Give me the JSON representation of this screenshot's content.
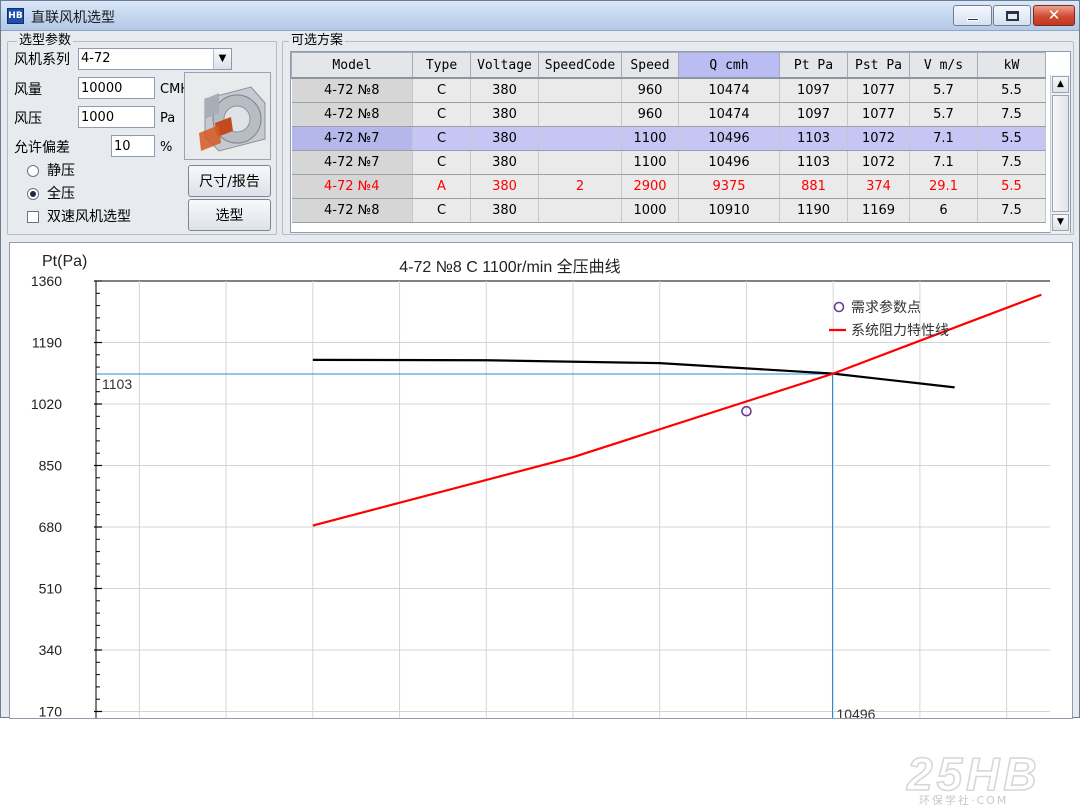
{
  "window": {
    "title": "直联风机选型",
    "icon": "app-icon"
  },
  "params": {
    "legend": "选型参数",
    "series_label": "风机系列",
    "series_value": "4-72",
    "flow_label": "风量",
    "flow_value": "10000",
    "flow_unit": "CMH",
    "pressure_label": "风压",
    "pressure_value": "1000",
    "pressure_unit": "Pa",
    "tolerance_label": "允许偏差",
    "tolerance_value": "10",
    "tolerance_unit": "%",
    "static_label": "静压",
    "total_label": "全压",
    "selected_pressure": "全压",
    "dual_speed_label": "双速风机选型",
    "dual_speed_checked": false,
    "report_button": "尺寸/报告",
    "select_button": "选型"
  },
  "options": {
    "legend": "可选方案",
    "columns": [
      "Model",
      "Type",
      "Voltage",
      "SpeedCode",
      "Speed",
      "Q cmh",
      "Pt Pa",
      "Pst Pa",
      "V m/s",
      "kW"
    ],
    "sorted_column": "Q cmh",
    "rows": [
      {
        "cells": [
          "4-72 №8",
          "C",
          "380",
          "",
          "960",
          "10474",
          "1097",
          "1077",
          "5.7",
          "5.5"
        ],
        "highlight": false,
        "red": false
      },
      {
        "cells": [
          "4-72 №8",
          "C",
          "380",
          "",
          "960",
          "10474",
          "1097",
          "1077",
          "5.7",
          "7.5"
        ],
        "highlight": false,
        "red": false
      },
      {
        "cells": [
          "4-72 №7",
          "C",
          "380",
          "",
          "1100",
          "10496",
          "1103",
          "1072",
          "7.1",
          "5.5"
        ],
        "highlight": true,
        "red": false
      },
      {
        "cells": [
          "4-72 №7",
          "C",
          "380",
          "",
          "1100",
          "10496",
          "1103",
          "1072",
          "7.1",
          "7.5"
        ],
        "highlight": false,
        "red": false
      },
      {
        "cells": [
          "4-72 №4",
          "A",
          "380",
          "2",
          "2900",
          "9375",
          "881",
          "374",
          "29.1",
          "5.5"
        ],
        "highlight": false,
        "red": true
      },
      {
        "cells": [
          "4-72 №8",
          "C",
          "380",
          "",
          "1000",
          "10910",
          "1190",
          "1169",
          "6",
          "7.5"
        ],
        "highlight": false,
        "red": false
      }
    ]
  },
  "chart_data": {
    "type": "line",
    "title": "4-72 №8 C  1100r/min   全压曲线",
    "ylabel": "Pt(Pa)",
    "xlabel": "",
    "ylim": [
      0,
      1360
    ],
    "xlim": [
      6250,
      11750
    ],
    "yticks": [
      170,
      340,
      510,
      680,
      850,
      1020,
      1190,
      1360
    ],
    "grid": true,
    "legend_position": "top-right",
    "series": [
      {
        "name": "",
        "color": "#000000",
        "x": [
          7500,
          8500,
          9500,
          10500,
          11200
        ],
        "y": [
          1142,
          1141,
          1133,
          1104,
          1066
        ]
      },
      {
        "name": "系统阻力特性线",
        "color": "#ff0000",
        "x": [
          7500,
          9000,
          10500,
          11700
        ],
        "y": [
          684,
          873,
          1104,
          1322
        ]
      }
    ],
    "demand_point": {
      "name": "需求参数点",
      "x": 10000,
      "y": 1000,
      "color": "#6b3a9a"
    },
    "crosshair": {
      "x": 10496,
      "y": 1103,
      "x_label": "10496",
      "y_label": "1103",
      "color": "#1e8fdc"
    }
  },
  "watermark": {
    "main": "25HB",
    "sub": "环保学社·COM"
  }
}
